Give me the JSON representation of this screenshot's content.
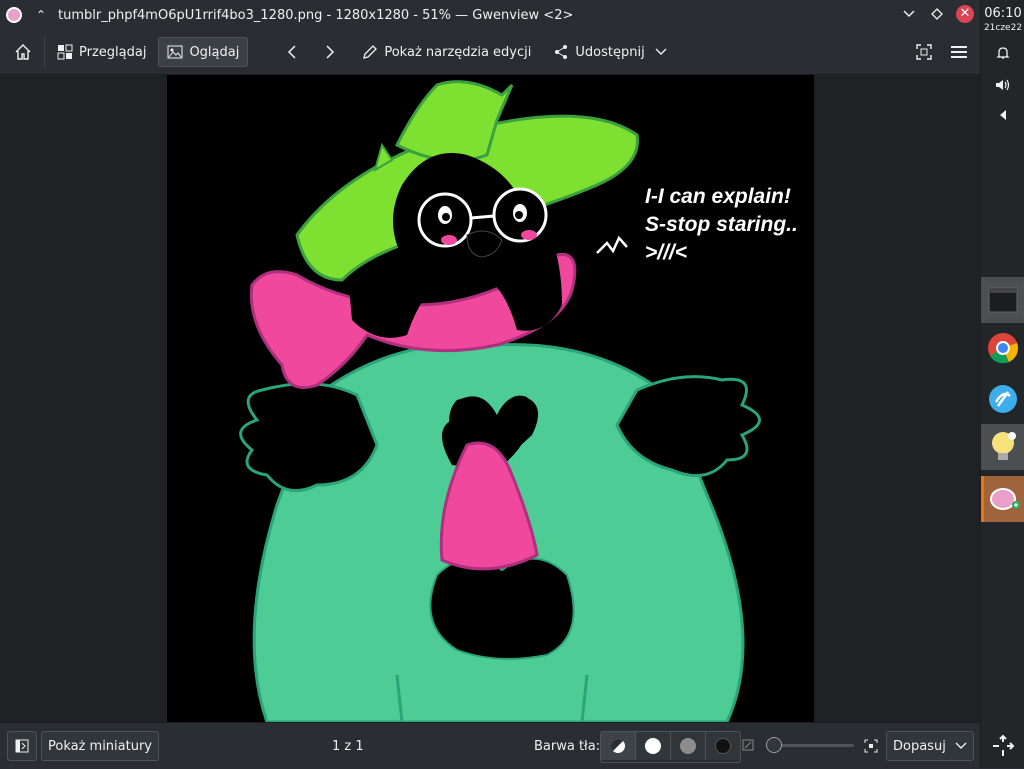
{
  "window": {
    "title": "tumblr_phpf4mO6pU1rrif4bo3_1280.png - 1280x1280 - 51% — Gwenview <2>"
  },
  "toolbar": {
    "browse_label": "Przeglądaj",
    "view_label": "Oglądaj",
    "edit_tools_label": "Pokaż narzędzia edycji",
    "share_label": "Udostępnij"
  },
  "image": {
    "speech": [
      "I-I can explain!",
      "S-stop staring..",
      ">///<"
    ]
  },
  "statusbar": {
    "thumbnails_label": "Pokaż miniatury",
    "page_counter": "1 z 1",
    "background_label": "Barwa tła:",
    "background_options": [
      "auto",
      "white",
      "gray",
      "black"
    ],
    "zoom_mode": "Dopasuj",
    "zoom_level": 0.51
  },
  "panel": {
    "time": "06:10",
    "date": "21cze22"
  },
  "colors": {
    "accent_close": "#da4453",
    "hat_green": "#7ee030",
    "robe_green": "#4ecc96",
    "scarf_pink": "#f0489c",
    "task_highlight": "#f67400"
  }
}
